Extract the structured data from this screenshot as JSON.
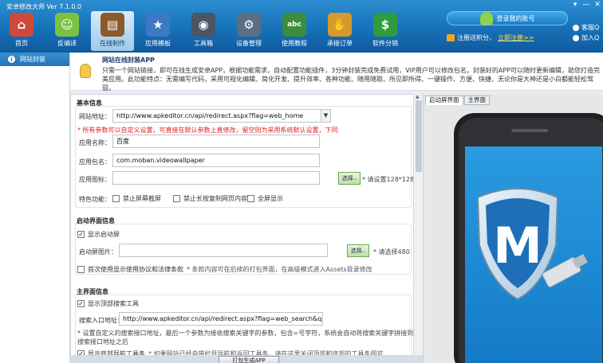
{
  "app": {
    "title": "安卓修改大师 Ver 7.1.0.0"
  },
  "toolbar": [
    {
      "label": "首页",
      "icon": "home-icon",
      "color": "#cf4a3a"
    },
    {
      "label": "反编译",
      "icon": "android-icon",
      "color": "#7cc242"
    },
    {
      "label": "在线制作",
      "icon": "briefcase-icon",
      "color": "#8b5a2b"
    },
    {
      "label": "应用模板",
      "icon": "star-icon",
      "color": "#3d78c4"
    },
    {
      "label": "工具箱",
      "icon": "speaker-icon",
      "color": "#4b5563"
    },
    {
      "label": "设备管理",
      "icon": "settings-gear-icon",
      "color": "#5a6f83"
    },
    {
      "label": "使用教程",
      "icon": "abc-board-icon",
      "color": "#3b8d3b"
    },
    {
      "label": "承接订单",
      "icon": "handshake-icon",
      "color": "#d39a2c"
    },
    {
      "label": "软件分销",
      "icon": "dollar-icon",
      "color": "#2e9c3e"
    }
  ],
  "account": {
    "login_label": "登录我的账号",
    "register_text": "注册送积分，",
    "register_link": "立即注册>>"
  },
  "service": {
    "item1": "客服Q",
    "item2": "加入Q"
  },
  "window_buttons": {
    "menu": "▾",
    "minimize": "—",
    "close": "✕"
  },
  "leftnav": {
    "item": "网站封装"
  },
  "intro": {
    "title": "网站在线封装APP",
    "text": "只需一个网站链接，即可在线生成安卓APP，根据功能需求，自动配置功能插件，3分钟封装完成免费试用，VIP用户可以修改包名，封装好的APP可以随时更新编辑，助您打造完美应用。此功能特点：无需编写代码，采用可视化编辑、简化开发、提升效率、各种功能、随用随取、所见即所得、一键操作、方便、快捷、无论你是大神还是小白都能轻松驾驭。"
  },
  "basic": {
    "title": "基本信息",
    "url_label": "网站地址：",
    "url_value": "http://www.apkeditor.cn/api/redirect.aspx?flag=web_home",
    "warning": "* 所有参数可以自定义设置，可直接在默认参数上直修改，留空则为采用系统默认设置，下同",
    "name_label": "应用名称：",
    "name_value": "百度",
    "pkg_label": "应用包名：",
    "pkg_value": "com.moban.videowallpaper",
    "icon_label": "应用图标：",
    "icon_value": "",
    "browse": "选择..",
    "icon_note": "* 请设置128*128",
    "features_label": "特色功能：",
    "features": [
      {
        "label": "禁止屏幕截屏",
        "checked": false
      },
      {
        "label": "禁止长按复制网页内容",
        "checked": false
      },
      {
        "label": "全屏显示",
        "checked": false
      }
    ]
  },
  "splash": {
    "title": "启动界面信息",
    "show_label": "显示启动屏",
    "show_checked": true,
    "image_label": "启动屏图片：",
    "image_value": "",
    "browse": "选择..",
    "image_note": "* 请选择480",
    "agreement_label": "首次使用显示使用协议和法律条款",
    "agreement_note": "* 条款内容可在后续的打包界面，在高级模式进入Assets目录修改",
    "agreement_checked": false
  },
  "main": {
    "title": "主界面信息",
    "top_search_label": "显示顶部搜索工具",
    "top_search_checked": true,
    "search_label": "搜索入口地址：",
    "search_value": "http://www.apkeditor.cn/api/redirect.aspx?flag=web_search&q=",
    "search_note_line1": "* 设置自定义的搜索接口地址，最后一个参数为接收搜索关键字的参数，包含=号字符，系统会自动将搜索关键字拼接到",
    "search_note_line2": "搜索接口地址之后",
    "nav_label": "显示底部导航工具条",
    "nav_note": "* 如果网站已经自带栏目导航和返回工具条，请在这里关闭顶部和底部的工具条即可",
    "nav_checked": true
  },
  "actions": {
    "generate": "打包生成APP"
  },
  "preview": {
    "tabs": [
      "启动屏界面",
      "主界面"
    ],
    "active_tab": 0,
    "logo_letter": "M"
  }
}
